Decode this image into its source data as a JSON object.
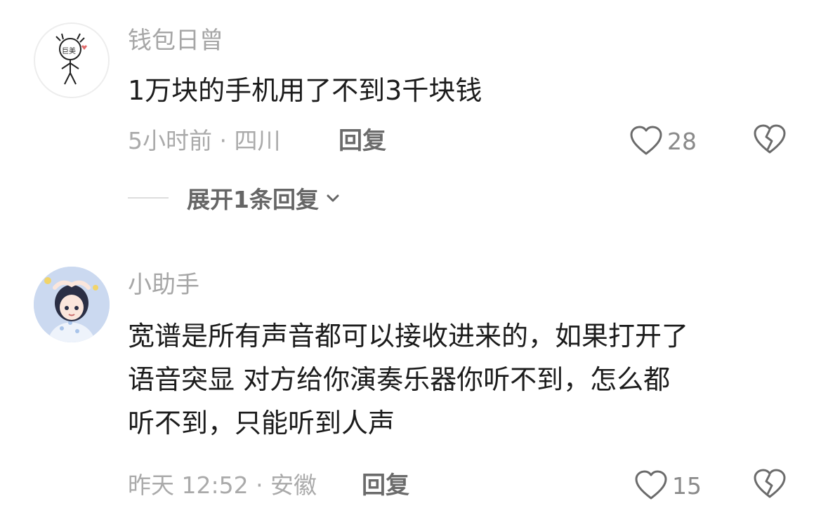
{
  "comments": [
    {
      "username": "钱包日曾",
      "text": "1万块的手机用了不到3千块钱",
      "meta": "5小时前 · 四川",
      "reply_label": "回复",
      "likes": "28",
      "expand_label": "展开1条回复",
      "avatar_text": "巨美"
    },
    {
      "username": "小助手",
      "text_lines": [
        "宽谱是所有声音都可以接收进来的，如果打开了",
        "语音突显  对方给你演奏乐器你听不到，怎么都",
        "听不到，只能听到人声"
      ],
      "meta": "昨天 12:52 · 安徽",
      "reply_label": "回复",
      "likes": "15"
    }
  ],
  "colors": {
    "text": "#1c1c1c",
    "meta": "#aaaaaa",
    "icon": "#6b6b6b"
  }
}
